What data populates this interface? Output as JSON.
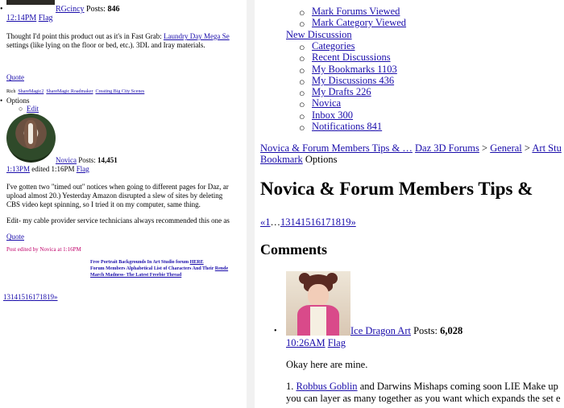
{
  "left": {
    "post1": {
      "username": "RGcincy",
      "posts_label": "Posts:",
      "posts_count": "846",
      "time": "12:14PM",
      "flag": "Flag",
      "body_text": "Thought I'd point this product out as it's in Fast Grab:",
      "body_link": "Laundry Day Mega Se",
      "body_text2": "settings (like lying on the floor or bed, etc.). 3DL and Iray materials.",
      "quote": "Quote",
      "sig_prefix": "Rich",
      "sig_links": [
        "ShareMagic2",
        "ShareMagic Roadmaker",
        "Creating Big City Scenes"
      ]
    },
    "options": {
      "label": "Options",
      "edit": "Edit"
    },
    "post2": {
      "username": "Novica",
      "posts_label": "Posts:",
      "posts_count": "14,451",
      "time": "1:13PM",
      "edited": "edited 1:16PM",
      "flag": "Flag",
      "para1_a": "I've gotten two \"timed out\" notices when going to different pages for Daz, ar",
      "para1_b": "upload almost 20.) Yesterday Amazon disrupted a slew of sites by deleting",
      "para1_c": "CBS video kept spinning, so I tried it on my computer, same thing.",
      "para2": "Edit- my cable provider service technicians always recommended this one as",
      "quote": "Quote",
      "edited_by": "Post edited by Novica at 1:16PM",
      "sig_line1": "Free Portrait Backgrounds In Art Studio forum",
      "sig_line1_link": "HERE",
      "sig_line2": "Forum Members Alphabetical List of Characters And Their",
      "sig_line2_link": "Rende",
      "sig_line3_link": "March Madness- The Latest Freebie Thread"
    },
    "pager": "13141516171819»"
  },
  "right": {
    "nav_sub1": [
      "Mark Forums Viewed",
      "Mark Category Viewed"
    ],
    "new_discussion": "New Discussion",
    "nav_sub2": [
      "Categories",
      "Recent Discussions",
      "My Bookmarks 1103",
      "My Discussions 436",
      "My Drafts 226",
      "Novica",
      "Inbox 300",
      "Notifications 841"
    ],
    "breadcrumb": {
      "item1": "Novica & Forum Members Tips & …",
      "sep": ">",
      "item2": "Daz 3D Forums",
      "item3": "General",
      "item4": "Art Stu"
    },
    "bookmark": "Bookmark",
    "options": "Options",
    "title": "Novica & Forum Members Tips &",
    "pager": {
      "prev": "«1",
      "ellipsis": "…",
      "pages": "13141516171819",
      "next": "»"
    },
    "comments_heading": "Comments",
    "comment": {
      "username": "Ice Dragon Art",
      "posts_label": "Posts:",
      "posts_count": "6,028",
      "time": "10:26AM",
      "flag": "Flag",
      "line1": "Okay here are mine.",
      "num": "1.",
      "link1": "Robbus Goblin",
      "line2_rest": "and Darwins Mishaps coming soon LIE Make up",
      "line3": "you can layer as many together as you want which expands the set e"
    }
  }
}
